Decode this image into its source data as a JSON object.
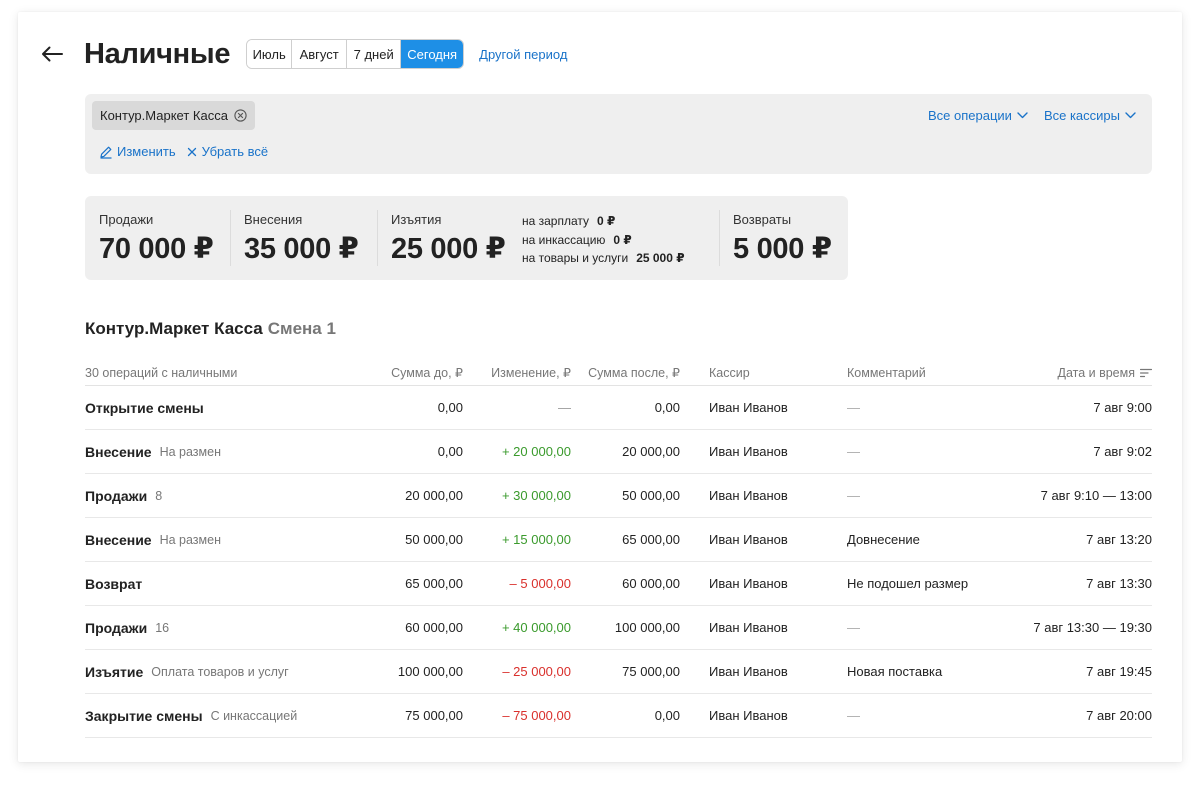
{
  "header": {
    "title": "Наличные",
    "periods": [
      {
        "label": "Июль",
        "active": false
      },
      {
        "label": "Август",
        "active": false
      },
      {
        "label": "7 дней",
        "active": false
      },
      {
        "label": "Сегодня",
        "active": true
      }
    ],
    "other_period": "Другой период"
  },
  "filters": {
    "chip": "Контур.Маркет Касса",
    "edit": "Изменить",
    "clear": "Убрать всё",
    "operations": "Все операции",
    "cashiers": "Все кассиры"
  },
  "stats": {
    "sales": {
      "label": "Продажи",
      "value": "70 000 ₽"
    },
    "deposits": {
      "label": "Внесения",
      "value": "35 000 ₽"
    },
    "withdrawals": {
      "label": "Изъятия",
      "value": "25 000 ₽"
    },
    "breakdown": [
      {
        "label": "на зарплату",
        "value": "0 ₽"
      },
      {
        "label": "на инкассацию",
        "value": "0 ₽"
      },
      {
        "label": "на товары и услуги",
        "value": "25 000 ₽"
      }
    ],
    "returns": {
      "label": "Возвраты",
      "value": "5 000 ₽"
    }
  },
  "section": {
    "title": "Контур.Маркет Касса",
    "shift": "Смена 1"
  },
  "table": {
    "columns": {
      "name": "30 операций с наличными",
      "before": "Сумма до, ₽",
      "change": "Изменение, ₽",
      "after": "Сумма после, ₽",
      "cashier": "Кассир",
      "comment": "Комментарий",
      "date": "Дата и время"
    },
    "rows": [
      {
        "name": "Открытие смены",
        "sub": "",
        "before": "0,00",
        "change": "—",
        "after": "0,00",
        "cashier": "Иван Иванов",
        "comment": "—",
        "date": "7 авг 9:00"
      },
      {
        "name": "Внесение",
        "sub": "На размен",
        "before": "0,00",
        "change": "+ 20 000,00",
        "after": "20 000,00",
        "cashier": "Иван Иванов",
        "comment": "—",
        "date": "7 авг 9:02"
      },
      {
        "name": "Продажи",
        "sub": "8",
        "before": "20 000,00",
        "change": "+ 30 000,00",
        "after": "50 000,00",
        "cashier": "Иван Иванов",
        "comment": "—",
        "date": "7 авг 9:10 — 13:00"
      },
      {
        "name": "Внесение",
        "sub": "На размен",
        "before": "50 000,00",
        "change": "+ 15 000,00",
        "after": "65 000,00",
        "cashier": "Иван Иванов",
        "comment": "Довнесение",
        "date": "7 авг 13:20"
      },
      {
        "name": "Возврат",
        "sub": "",
        "before": "65 000,00",
        "change": "– 5 000,00",
        "after": "60 000,00",
        "cashier": "Иван Иванов",
        "comment": "Не подошел размер",
        "date": "7 авг 13:30"
      },
      {
        "name": "Продажи",
        "sub": "16",
        "before": "60 000,00",
        "change": "+ 40 000,00",
        "after": "100 000,00",
        "cashier": "Иван Иванов",
        "comment": "—",
        "date": "7 авг 13:30 — 19:30"
      },
      {
        "name": "Изъятие",
        "sub": "Оплата товаров и услуг",
        "before": "100 000,00",
        "change": "– 25 000,00",
        "after": "75 000,00",
        "cashier": "Иван Иванов",
        "comment": "Новая поставка",
        "date": "7 авг 19:45"
      },
      {
        "name": "Закрытие смены",
        "sub": "С инкассацией",
        "before": "75 000,00",
        "change": "– 75 000,00",
        "after": "0,00",
        "cashier": "Иван Иванов",
        "comment": "—",
        "date": "7 авг 20:00"
      }
    ]
  },
  "colors": {
    "accent": "#1e8fe6",
    "link": "#1a73c9",
    "positive": "#3a9a2c",
    "negative": "#d9302c",
    "panel": "#efefef"
  }
}
